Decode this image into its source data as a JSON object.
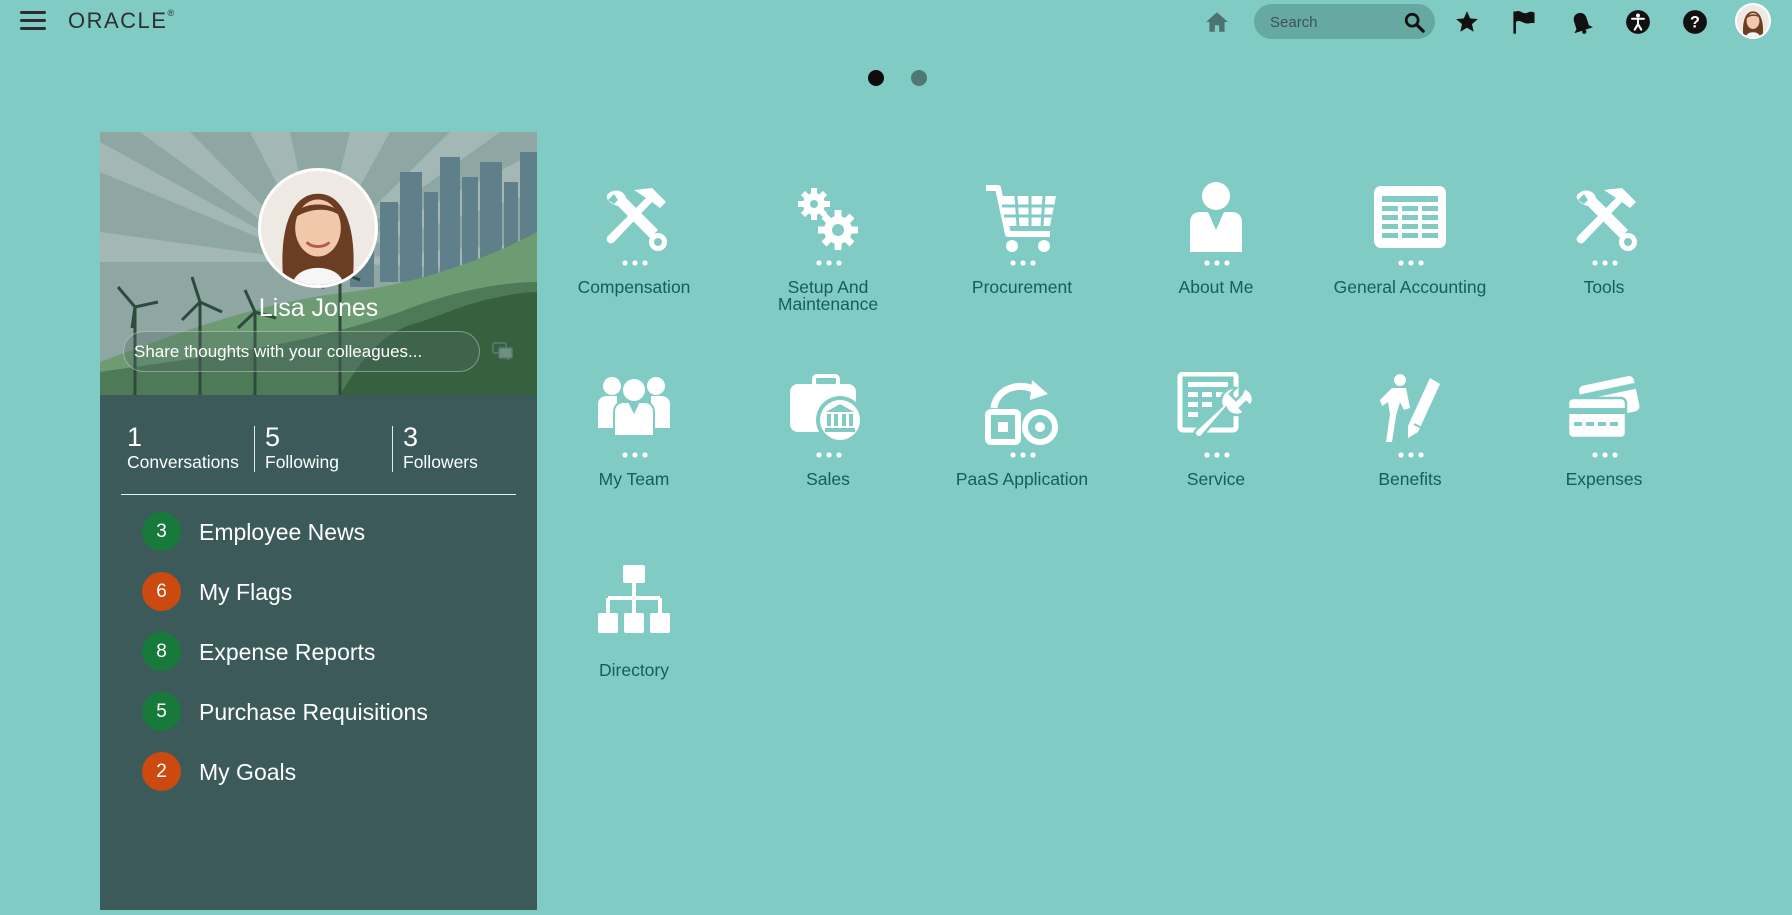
{
  "header": {
    "logo_text": "ORACLE",
    "logo_mark": "®",
    "search_placeholder": "Search"
  },
  "icons": {
    "menu": "hamburger-menu-icon",
    "home": "home-icon",
    "search": "search-icon",
    "favorites": "star-icon",
    "flags": "flag-icon",
    "notifications": "bell-icon",
    "accessibility": "accessibility-icon",
    "help": "help-icon"
  },
  "pager": {
    "pages": 2,
    "current": 1
  },
  "profile": {
    "name": "Lisa Jones",
    "share_placeholder": "Share thoughts with your colleagues...",
    "stats": [
      {
        "count": "1",
        "label": "Conversations"
      },
      {
        "count": "5",
        "label": "Following"
      },
      {
        "count": "3",
        "label": "Followers"
      }
    ]
  },
  "quick_links": [
    {
      "count": "3",
      "label": "Employee News",
      "badge_color": "#177a3a"
    },
    {
      "count": "6",
      "label": "My Flags",
      "badge_color": "#cc4a10"
    },
    {
      "count": "8",
      "label": "Expense Reports",
      "badge_color": "#177a3a"
    },
    {
      "count": "5",
      "label": "Purchase Requisitions",
      "badge_color": "#177a3a"
    },
    {
      "count": "2",
      "label": "My Goals",
      "badge_color": "#cc4a10"
    }
  ],
  "apps": [
    {
      "label": "Compensation",
      "icon": "tools-icon"
    },
    {
      "label": "Setup And Maintenance",
      "icon": "gears-icon"
    },
    {
      "label": "Procurement",
      "icon": "cart-icon"
    },
    {
      "label": "About Me",
      "icon": "person-icon"
    },
    {
      "label": "General Accounting",
      "icon": "ledger-icon"
    },
    {
      "label": "Tools",
      "icon": "tools-icon"
    },
    {
      "label": "My Team",
      "icon": "team-icon"
    },
    {
      "label": "Sales",
      "icon": "briefcase-bank-icon"
    },
    {
      "label": "PaaS Application",
      "icon": "paas-icon"
    },
    {
      "label": "Service",
      "icon": "service-icon"
    },
    {
      "label": "Benefits",
      "icon": "benefits-icon"
    },
    {
      "label": "Expenses",
      "icon": "cards-icon"
    },
    {
      "label": "Directory",
      "icon": "org-chart-icon"
    }
  ],
  "colors": {
    "background": "#80cbc4",
    "panel": "#3b5a59",
    "app_label": "#175d58",
    "badge_green": "#177a3a",
    "badge_orange": "#cc4a10"
  }
}
